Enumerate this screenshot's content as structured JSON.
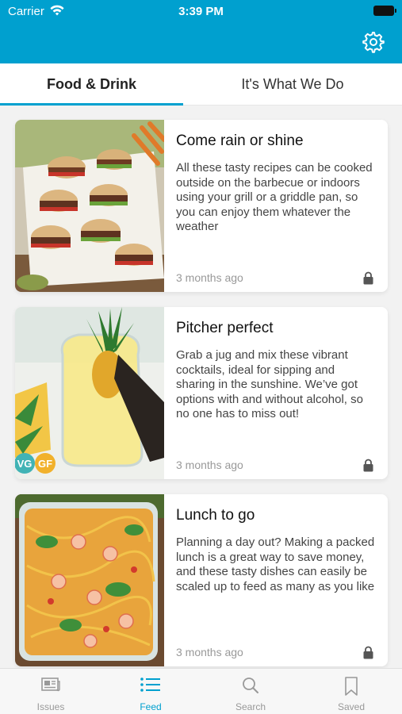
{
  "status_bar": {
    "carrier": "Carrier",
    "time": "3:39 PM"
  },
  "header": {
    "settings_icon": "gear-icon",
    "background": "#00a0cf"
  },
  "tabs": [
    {
      "label": "Food & Drink",
      "active": true
    },
    {
      "label": "It's What We Do",
      "active": false
    }
  ],
  "articles": [
    {
      "title": "Come rain or shine",
      "description": "All these tasty recipes can be cooked outside on the barbecue or indoors using your grill or a griddle pan, so you can enjoy them whatever the weather",
      "date": "3 months ago",
      "locked": true,
      "image": "grilled-burgers-photo"
    },
    {
      "title": "Pitcher perfect",
      "description": "Grab a jug and mix these vibrant cocktails, ideal for sipping and sharing in the sunshine. We’ve got options with and without alcohol, so no one has to miss out!",
      "date": "3 months ago",
      "locked": true,
      "image": "pineapple-pitcher-photo",
      "badges": [
        "VG",
        "GF"
      ]
    },
    {
      "title": "Lunch to go",
      "description": "Planning a day out? Making a packed lunch is a great way to save money, and these tasty dishes can easily be scaled up to feed as many as you like",
      "date": "3 months ago",
      "locked": true,
      "image": "noodle-salad-photo"
    }
  ],
  "tab_bar": {
    "items": [
      {
        "label": "Issues",
        "icon": "newspaper-icon",
        "active": false
      },
      {
        "label": "Feed",
        "icon": "list-icon",
        "active": true
      },
      {
        "label": "Search",
        "icon": "search-icon",
        "active": false
      },
      {
        "label": "Saved",
        "icon": "bookmark-icon",
        "active": false
      }
    ]
  },
  "colors": {
    "accent": "#00a0cf",
    "muted": "#999999"
  }
}
